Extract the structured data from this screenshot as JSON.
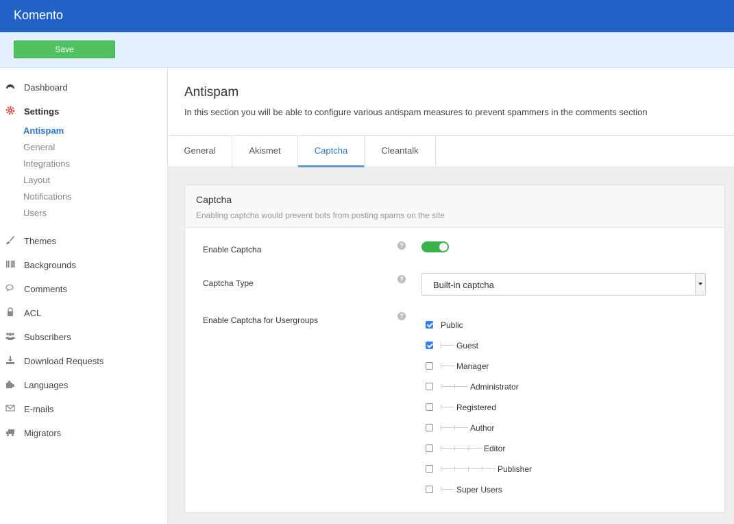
{
  "app": {
    "title": "Komento"
  },
  "toolbar": {
    "save_label": "Save"
  },
  "sidebar": {
    "items": [
      {
        "label": "Dashboard",
        "icon": "dashboard-icon"
      },
      {
        "label": "Settings",
        "icon": "gear-icon"
      },
      {
        "label": "Themes",
        "icon": "brush-icon"
      },
      {
        "label": "Backgrounds",
        "icon": "barcode-icon"
      },
      {
        "label": "Comments",
        "icon": "comments-icon"
      },
      {
        "label": "ACL",
        "icon": "lock-icon"
      },
      {
        "label": "Subscribers",
        "icon": "users-icon"
      },
      {
        "label": "Download Requests",
        "icon": "download-icon"
      },
      {
        "label": "Languages",
        "icon": "puzzle-icon"
      },
      {
        "label": "E-mails",
        "icon": "envelope-icon"
      },
      {
        "label": "Migrators",
        "icon": "truck-icon"
      }
    ],
    "settings_children": [
      "Antispam",
      "General",
      "Integrations",
      "Layout",
      "Notifications",
      "Users"
    ]
  },
  "header": {
    "title": "Antispam",
    "description": "In this section you will be able to configure various antispam measures to prevent spammers in the comments section"
  },
  "tabs": [
    "General",
    "Akismet",
    "Captcha",
    "Cleantalk"
  ],
  "panel": {
    "title": "Captcha",
    "subtitle": "Enabling captcha would prevent bots from posting spams on the site",
    "enable_label": "Enable Captcha",
    "enable_value": true,
    "type_label": "Captcha Type",
    "type_value": "Built-in captcha",
    "groups_label": "Enable Captcha for Usergroups",
    "help_glyph": "?",
    "usergroups": [
      {
        "name": "Public",
        "checked": true
      },
      {
        "name": "Guest",
        "checked": true
      },
      {
        "name": "Manager",
        "checked": false
      },
      {
        "name": "Administrator",
        "checked": false
      },
      {
        "name": "Registered",
        "checked": false
      },
      {
        "name": "Author",
        "checked": false
      },
      {
        "name": "Editor",
        "checked": false
      },
      {
        "name": "Publisher",
        "checked": false
      },
      {
        "name": "Super Users",
        "checked": false
      }
    ]
  },
  "colors": {
    "topbar": "#2062c5",
    "save": "#51c160",
    "accent": "#2a76c6",
    "toggle": "#3ab14a"
  }
}
